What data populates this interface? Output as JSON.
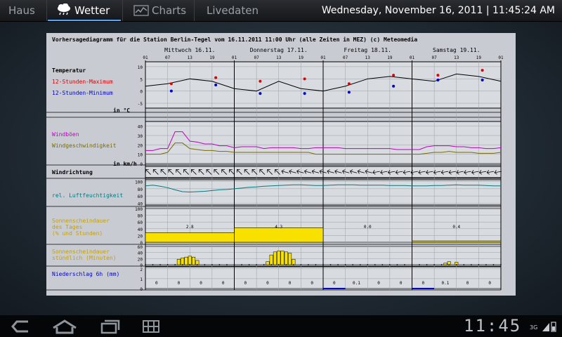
{
  "tabs": [
    {
      "label": "Haus"
    },
    {
      "label": "Wetter"
    },
    {
      "label": "Charts"
    },
    {
      "label": "Livedaten"
    }
  ],
  "datetime": "Wednesday, November 16, 2011 | 11:45:24 AM",
  "statusbar": {
    "clock": "11:45",
    "network": "3G"
  },
  "diagram": {
    "header": "Vorhersagediagramm für die Station Berlin-Tegel vom 16.11.2011 11:00 Uhr (alle Zeiten in MEZ)  (c) Meteomedia",
    "days": [
      "Mittwoch 16.11.",
      "Donnerstag 17.11.",
      "Freitag 18.11.",
      "Samstag 19.11."
    ],
    "hour_labels": [
      "01",
      "07",
      "13",
      "19",
      "01",
      "07",
      "13",
      "19",
      "01",
      "07",
      "13",
      "19",
      "01",
      "07",
      "13",
      "19",
      "01"
    ],
    "labels": {
      "temperatur": "Temperatur",
      "max": "12-Stunden-Maximum",
      "min": "12-Stunden-Minimum",
      "temp_unit": "in °C",
      "windboen": "Windböen",
      "windgeschw": "Windgeschwindigkeit",
      "wind_unit": "in km/h",
      "windrichtung": "Windrichtung",
      "feuchte": "rel. Luftfeuchtigkeit",
      "sonne_tag": [
        "Sonnenscheindauer",
        "des Tages",
        "(% und Stunden)"
      ],
      "sonne_std": [
        "Sonnenscheindauer",
        "stündlich (Minuten)"
      ],
      "niederschlag": "Niederschlag 6h (mm)"
    },
    "axes": {
      "temp": [
        "10",
        "5",
        "0",
        "-5"
      ],
      "wind": [
        "40",
        "30",
        "20",
        "10",
        "0"
      ],
      "humidity": [
        "100",
        "80",
        "60",
        "40"
      ],
      "sun_day": [
        "100",
        "80",
        "60",
        "40",
        "20",
        "0"
      ],
      "sun_hour": [
        "60",
        "40",
        "20",
        "0"
      ],
      "precip": [
        "2",
        "1",
        "0"
      ]
    }
  },
  "chart_data": {
    "type": "line",
    "x_hours_from_start": [
      0,
      6,
      12,
      18,
      24,
      30,
      36,
      42,
      48,
      54,
      60,
      66,
      72,
      78,
      84,
      90,
      96
    ],
    "temperature": [
      2,
      3,
      5,
      4,
      1,
      0,
      4,
      1,
      0,
      2,
      5,
      6,
      5,
      4,
      7,
      6,
      4
    ],
    "max_12h": [
      {
        "h": 7,
        "v": 3
      },
      {
        "h": 19,
        "v": 5.5
      },
      {
        "h": 31,
        "v": 4
      },
      {
        "h": 43,
        "v": 5
      },
      {
        "h": 55,
        "v": 3
      },
      {
        "h": 67,
        "v": 6.5
      },
      {
        "h": 79,
        "v": 6.5
      },
      {
        "h": 91,
        "v": 8.5
      }
    ],
    "min_12h": [
      {
        "h": 7,
        "v": 0
      },
      {
        "h": 19,
        "v": 2.5
      },
      {
        "h": 31,
        "v": -1
      },
      {
        "h": 43,
        "v": -1
      },
      {
        "h": 55,
        "v": -0.5
      },
      {
        "h": 67,
        "v": 2
      },
      {
        "h": 79,
        "v": 4.5
      },
      {
        "h": 91,
        "v": 4.5
      }
    ],
    "wind_gusts": [
      14,
      14,
      16,
      16,
      34,
      34,
      24,
      23,
      21,
      21,
      19,
      19,
      17,
      18,
      18,
      18,
      16,
      17,
      17,
      17,
      17,
      16,
      16,
      17,
      17,
      17,
      17,
      16,
      16,
      16,
      16,
      16,
      16,
      16,
      15,
      15,
      15,
      15,
      18,
      19,
      19,
      19,
      18,
      18,
      17,
      17,
      16,
      16,
      17
    ],
    "wind_speed": [
      10,
      10,
      10,
      12,
      22,
      22,
      16,
      15,
      14,
      14,
      13,
      13,
      12,
      12,
      12,
      12,
      12,
      12,
      12,
      12,
      12,
      12,
      12,
      10,
      10,
      10,
      10,
      10,
      10,
      10,
      10,
      10,
      10,
      10,
      10,
      10,
      10,
      10,
      11,
      12,
      12,
      13,
      12,
      12,
      12,
      11,
      11,
      11,
      12
    ],
    "humidity": [
      88,
      90,
      87,
      83,
      77,
      72,
      71,
      72,
      73,
      75,
      77,
      78,
      80,
      82,
      84,
      85,
      87,
      88,
      89,
      90,
      91,
      91,
      90,
      89,
      89,
      90,
      91,
      91,
      91,
      90,
      90,
      90,
      90,
      89,
      89,
      89,
      88,
      88,
      88,
      89,
      89,
      90,
      91,
      90,
      90,
      90,
      89,
      88,
      88
    ],
    "sun_per_day": [
      {
        "day": "Mittwoch 16.11.",
        "hours": 2.8
      },
      {
        "day": "Donnerstag 17.11.",
        "hours": 4.3
      },
      {
        "day": "Freitag 18.11.",
        "hours": 0.0
      },
      {
        "day": "Samstag 19.11.",
        "hours": 0.4
      }
    ],
    "sun_day_labels": [
      "2.8",
      "4.3",
      "0.0",
      "0.4"
    ],
    "sun_hourly_minutes": [
      {
        "h": 9,
        "v": 18
      },
      {
        "h": 10,
        "v": 22
      },
      {
        "h": 11,
        "v": 25
      },
      {
        "h": 12,
        "v": 28
      },
      {
        "h": 13,
        "v": 25
      },
      {
        "h": 14,
        "v": 14
      },
      {
        "h": 33,
        "v": 10
      },
      {
        "h": 34,
        "v": 32
      },
      {
        "h": 35,
        "v": 42
      },
      {
        "h": 36,
        "v": 45
      },
      {
        "h": 37,
        "v": 45
      },
      {
        "h": 38,
        "v": 42
      },
      {
        "h": 39,
        "v": 38
      },
      {
        "h": 40,
        "v": 18
      },
      {
        "h": 81,
        "v": 5
      },
      {
        "h": 82,
        "v": 10
      },
      {
        "h": 84,
        "v": 8
      }
    ],
    "precip_6h": [
      "0",
      "0",
      "0",
      "0",
      "0",
      "0",
      "0",
      "0",
      "0",
      "0.1",
      "0",
      "0",
      "0",
      "0.1",
      "0",
      "0"
    ],
    "wind_direction_arrows": 47
  }
}
